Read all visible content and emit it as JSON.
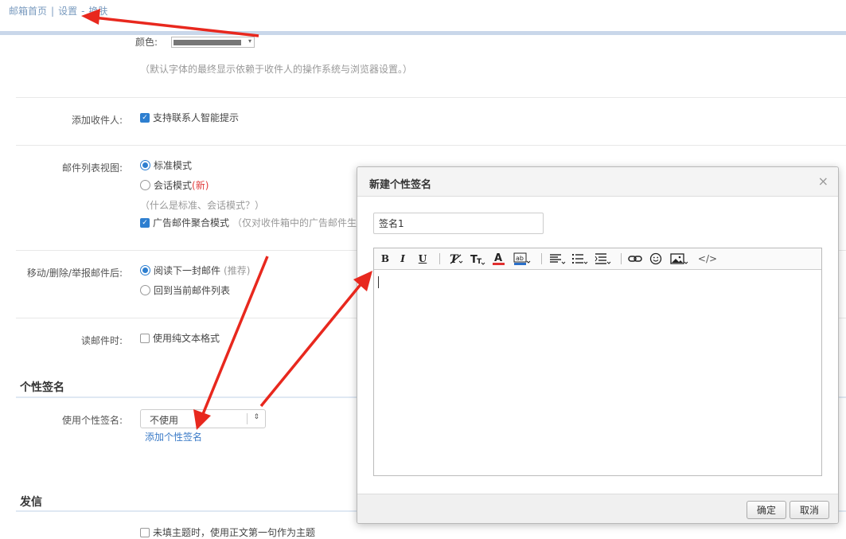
{
  "breadcrumb": {
    "home": "邮箱首页",
    "settings": "设置",
    "theme": "换肤"
  },
  "font": {
    "label": "颜色:",
    "hint": "（默认字体的最终显示依赖于收件人的操作系统与浏览器设置。）"
  },
  "add_recipient": {
    "label": "添加收件人:",
    "option": "支持联系人智能提示"
  },
  "list_view": {
    "label": "邮件列表视图:",
    "standard": "标准模式",
    "conversation": "会话模式",
    "new_tag": "(新)",
    "whatis": "（什么是标准、会话模式？）",
    "ad_aggregate": "广告邮件聚合模式",
    "ad_hint": "（仅对收件箱中的广告邮件生效"
  },
  "after_move": {
    "label": "移动/删除/举报邮件后:",
    "next": "阅读下一封邮件",
    "recommend": "(推荐)",
    "back": "回到当前邮件列表"
  },
  "reading": {
    "label": "读邮件时:",
    "plain": "使用纯文本格式"
  },
  "signature": {
    "section": "个性签名",
    "label": "使用个性签名:",
    "selected": "不使用",
    "add_link": "添加个性签名"
  },
  "send": {
    "section": "发信",
    "subject_opt": "未填主题时，使用正文第一句作为主题"
  },
  "dialog": {
    "title": "新建个性签名",
    "close": "×",
    "name_value": "签名1",
    "toolbar": {
      "bold": "B",
      "italic": "I",
      "underline": "U",
      "code": "</>"
    },
    "ok": "确定",
    "cancel": "取消"
  },
  "colors": {
    "accent": "#2e7fd0",
    "link": "#3b7bc7",
    "annotation_arrow": "#e8281e"
  }
}
